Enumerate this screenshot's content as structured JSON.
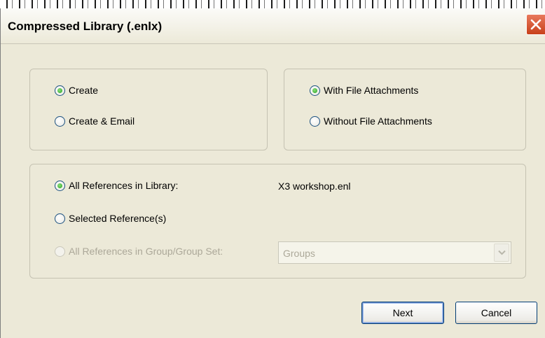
{
  "dialog": {
    "title": "Compressed Library (.enlx)"
  },
  "icons": {
    "close": "close-icon",
    "dropdown": "chevron-down-icon"
  },
  "colors": {
    "close_button": "#c8411b",
    "radio_checked": "#21a121",
    "button_border": "#003c74",
    "disabled_text": "#aca899"
  },
  "action_group": {
    "options": [
      {
        "label": "Create",
        "checked": true,
        "enabled": true
      },
      {
        "label": "Create & Email",
        "checked": false,
        "enabled": true
      }
    ]
  },
  "attachment_group": {
    "options": [
      {
        "label": "With File Attachments",
        "checked": true,
        "enabled": true
      },
      {
        "label": "Without File Attachments",
        "checked": false,
        "enabled": true
      }
    ]
  },
  "reference_group": {
    "options": [
      {
        "label": "All References in Library:",
        "checked": true,
        "enabled": true
      },
      {
        "label": "Selected Reference(s)",
        "checked": false,
        "enabled": true
      },
      {
        "label": "All References in Group/Group Set:",
        "checked": false,
        "enabled": false
      }
    ],
    "library_name": "X3 workshop.enl",
    "group_select": {
      "value": "Groups",
      "enabled": false
    }
  },
  "buttons": {
    "next": "Next",
    "cancel": "Cancel"
  }
}
